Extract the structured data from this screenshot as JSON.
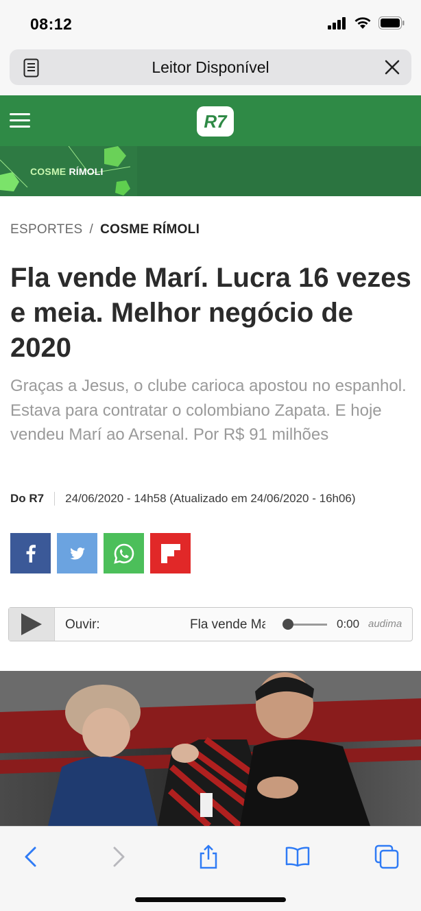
{
  "status_bar": {
    "time": "08:12"
  },
  "browser": {
    "reader_label": "Leitor Disponível",
    "icons": [
      "reader-mode-icon",
      "close-icon",
      "back-icon",
      "forward-icon",
      "share-icon",
      "bookmarks-icon",
      "tabs-icon"
    ]
  },
  "site": {
    "logo": "R7",
    "banner_first": "COSME ",
    "banner_second": "RÍMOLI",
    "brand_color": "#2f8a46"
  },
  "breadcrumb": {
    "section": "ESPORTES",
    "separator": "/",
    "column": "COSME RÍMOLI"
  },
  "article": {
    "headline": "Fla vende Marí. Lucra 16 vezes e meia. Melhor negócio de 2020",
    "subhead": "Graças a Jesus, o clube carioca  apostou no espanhol. Estava para contratar o colombiano Zapata. E hoje vendeu Marí ao Arsenal. Por R$ 91 milhões",
    "author": "Do R7",
    "date": "24/06/2020 - 14h58 (Atualizado em 24/06/2020 - 16h06)"
  },
  "share": {
    "buttons": [
      {
        "name": "facebook",
        "color": "#3b5998"
      },
      {
        "name": "twitter",
        "color": "#6ba3e0"
      },
      {
        "name": "whatsapp",
        "color": "#4cbf5a"
      },
      {
        "name": "flipboard",
        "color": "#e12828"
      }
    ]
  },
  "player": {
    "label": "Ouvir:",
    "title": "Fla vende Marí",
    "time": "0:00",
    "brand": "audima",
    "progress": 0
  }
}
